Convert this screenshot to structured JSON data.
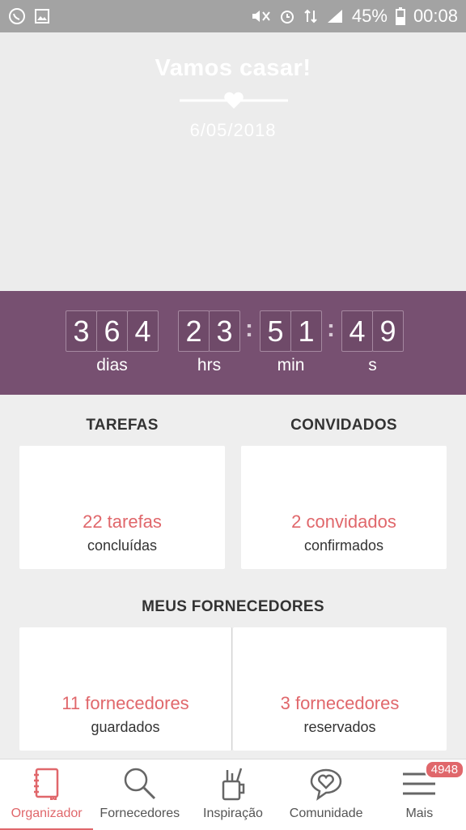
{
  "status_bar": {
    "battery_percent": "45%",
    "time": "00:08",
    "icons_left": [
      "whatsapp-icon",
      "image-icon"
    ],
    "icons_right": [
      "mute-icon",
      "alarm-icon",
      "data-icon",
      "signal-icon",
      "battery-icon"
    ]
  },
  "hero": {
    "title": "Vamos casar!",
    "date": "6/05/2018"
  },
  "countdown": {
    "days": [
      "3",
      "6",
      "4"
    ],
    "hours": [
      "2",
      "3"
    ],
    "minutes": [
      "5",
      "1"
    ],
    "seconds": [
      "4",
      "9"
    ],
    "labels": {
      "days": "dias",
      "hours": "hrs",
      "minutes": "min",
      "seconds": "s"
    }
  },
  "tasks": {
    "title": "TAREFAS",
    "value": "22 tarefas",
    "sub": "concluídas"
  },
  "guests": {
    "title": "CONVIDADOS",
    "value": "2 convidados",
    "sub": "confirmados"
  },
  "suppliers": {
    "title": "MEUS FORNECEDORES",
    "saved_value": "11 fornecedores",
    "saved_sub": "guardados",
    "booked_value": "3 fornecedores",
    "booked_sub": "reservados"
  },
  "nav": {
    "items": [
      {
        "label": "Organizador",
        "icon": "notebook-icon",
        "active": true
      },
      {
        "label": "Fornecedores",
        "icon": "search-icon"
      },
      {
        "label": "Inspiração",
        "icon": "pencil-cup-icon"
      },
      {
        "label": "Comunidade",
        "icon": "heart-chat-icon"
      },
      {
        "label": "Mais",
        "icon": "menu-icon",
        "badge": "4948"
      }
    ]
  },
  "colors": {
    "accent": "#e0676b",
    "countdown_bg": "#775071"
  }
}
